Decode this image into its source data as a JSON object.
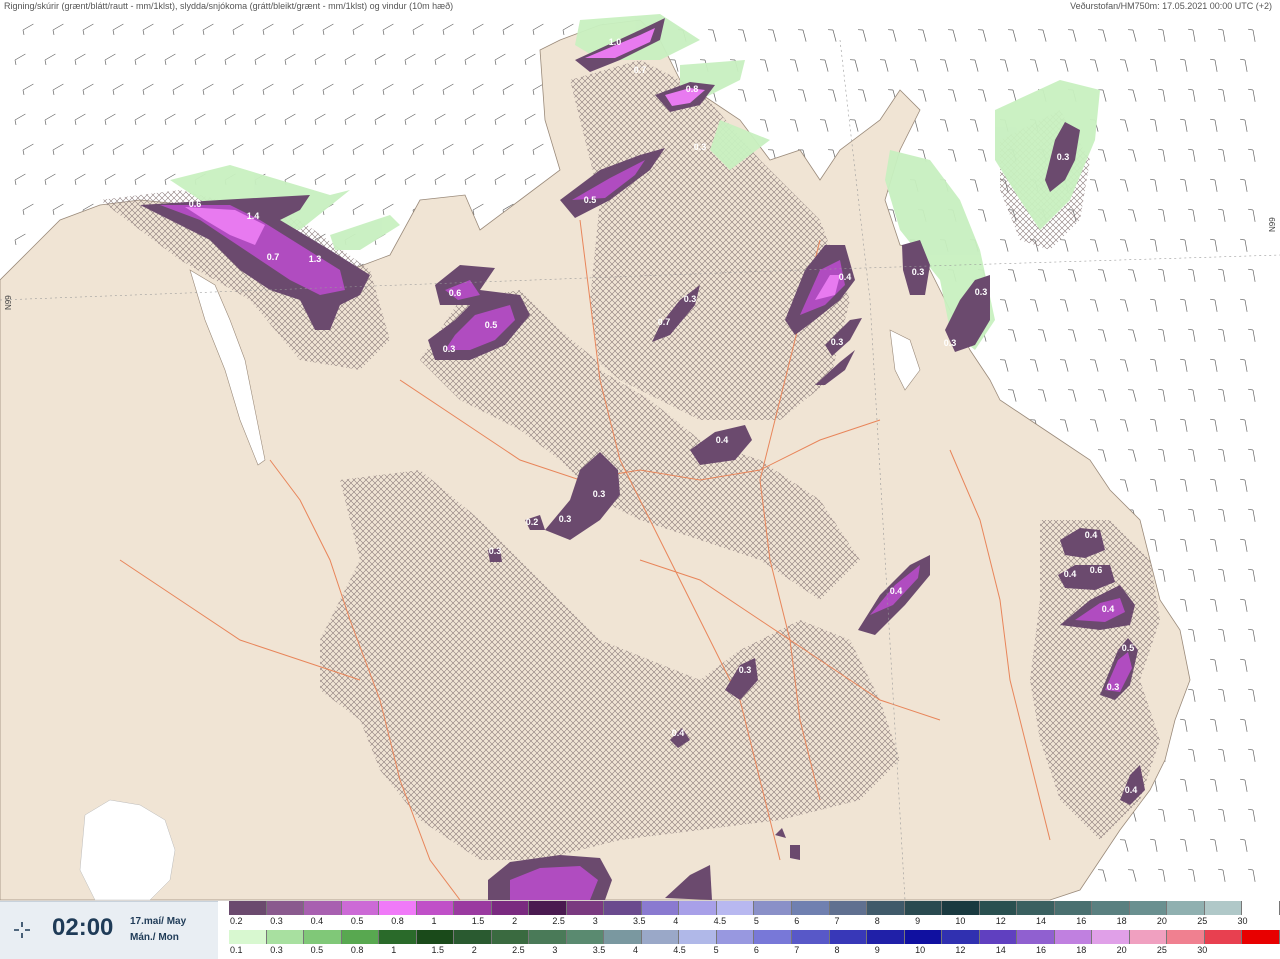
{
  "header": {
    "left_title": "Rigning/skúrir (grænt/blátt/rautt - mm/1klst), slydda/snjókoma (grátt/bleikt/grænt - mm/1klst) og vindur (10m hæð)",
    "right_title": "Veðurstofan/HM750m: 17.05.2021 00:00 UTC (+2)"
  },
  "map": {
    "graticule_labels": [
      "N99",
      "N99"
    ],
    "colors": {
      "sea": "#ffffff",
      "land": "#f0e4d4",
      "rivers": "#e8855a",
      "snow_purple_dark": "#6b4a6e",
      "snow_purple_mid": "#b04cc0",
      "snow_pink": "#e87af0",
      "rain_green": "#c8f0c0",
      "hatch": "#8a7a7a"
    },
    "precip_labels": [
      {
        "text": "0.6"
      },
      {
        "text": "1.4"
      },
      {
        "text": "0.7"
      },
      {
        "text": "1.3"
      },
      {
        "text": "1.0"
      },
      {
        "text": "0.7"
      },
      {
        "text": "0.8"
      },
      {
        "text": "0.3"
      },
      {
        "text": "0.5"
      },
      {
        "text": "0.6"
      },
      {
        "text": "0.5"
      },
      {
        "text": "0.3"
      },
      {
        "text": "0.3"
      },
      {
        "text": "0.7"
      },
      {
        "text": "0.4"
      },
      {
        "text": "0.3"
      },
      {
        "text": "0.3"
      },
      {
        "text": "0.3"
      },
      {
        "text": "0.3"
      },
      {
        "text": "0.4"
      },
      {
        "text": "0.3"
      },
      {
        "text": "0.3"
      },
      {
        "text": "0.2"
      },
      {
        "text": "0.3"
      },
      {
        "text": "0.4"
      },
      {
        "text": "0.4"
      },
      {
        "text": "0.4"
      },
      {
        "text": "0.6"
      },
      {
        "text": "0.4"
      },
      {
        "text": "0.5"
      },
      {
        "text": "0.3"
      },
      {
        "text": "0.3"
      },
      {
        "text": "0.4"
      },
      {
        "text": "0.4"
      },
      {
        "text": "0.3"
      }
    ]
  },
  "time_panel": {
    "icon": "sun-icon",
    "time": "02:00",
    "date_line1": "17.maí/ May",
    "date_line2": "Mán./ Mon"
  },
  "legend": {
    "row1": {
      "colors": [
        "#6b4a6e",
        "#8a5a8e",
        "#a860b0",
        "#cc6ad6",
        "#f07af8",
        "#c050c8",
        "#9a3aa0",
        "#7a2a80",
        "#4a1a50",
        "#7a3a80",
        "#6a4a8e",
        "#8a7ad0",
        "#a8a0e8",
        "#b8b8f0",
        "#8a90c8",
        "#7080b0",
        "#607090",
        "#405a6a",
        "#2a4a50",
        "#1a3a40",
        "#2a5050",
        "#3a6060",
        "#4a7070",
        "#5a8080",
        "#6a9090",
        "#90b0b0",
        "#b0c8c8",
        "#ffffff"
      ],
      "labels": [
        "0.2",
        "0.3",
        "0.4",
        "0.5",
        "0.8",
        "1",
        "1.5",
        "2",
        "2.5",
        "3",
        "3.5",
        "4",
        "4.5",
        "5",
        "6",
        "7",
        "8",
        "9",
        "10",
        "12",
        "14",
        "16",
        "18",
        "20",
        "25",
        "30"
      ]
    },
    "row2": {
      "colors": [
        "#d8f8d0",
        "#a8e0a0",
        "#80c878",
        "#58a850",
        "#2a6a2a",
        "#1a4a1a",
        "#2a5a30",
        "#3a6a40",
        "#4a7a58",
        "#5a8a70",
        "#7a98a0",
        "#9aa8c8",
        "#b0b8e8",
        "#9898e0",
        "#7878d8",
        "#5858c8",
        "#3838b8",
        "#2020a8",
        "#1010a0",
        "#3030b0",
        "#6040c0",
        "#9060d0",
        "#c080e0",
        "#e0a0e8",
        "#f0a0c0",
        "#f08090",
        "#e84050",
        "#e80000"
      ],
      "labels": [
        "0.1",
        "0.3",
        "0.5",
        "0.8",
        "1",
        "1.5",
        "2",
        "2.5",
        "3",
        "3.5",
        "4",
        "4.5",
        "5",
        "6",
        "7",
        "8",
        "9",
        "10",
        "12",
        "14",
        "16",
        "18",
        "20",
        "25",
        "30"
      ]
    }
  }
}
